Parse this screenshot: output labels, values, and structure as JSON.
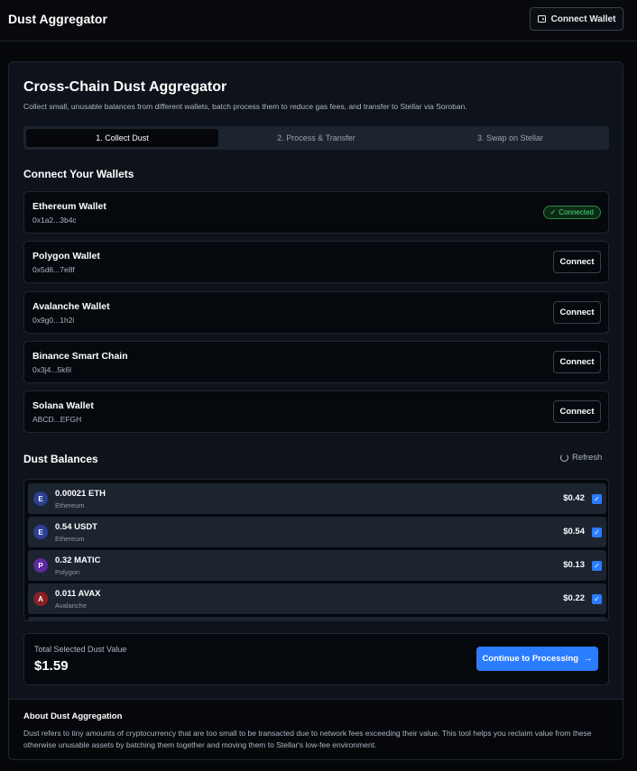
{
  "header": {
    "app_title": "Dust Aggregator",
    "connect_wallet_label": "Connect Wallet"
  },
  "main": {
    "title": "Cross-Chain Dust Aggregator",
    "subtitle": "Collect small, unusable balances from different wallets, batch process them to reduce gas fees, and transfer to Stellar via Soroban.",
    "steps": [
      {
        "label": "1. Collect Dust",
        "active": true
      },
      {
        "label": "2. Process & Transfer",
        "active": false
      },
      {
        "label": "3. Swap on Stellar",
        "active": false
      }
    ],
    "wallets_title": "Connect Your Wallets",
    "wallets": [
      {
        "name": "Ethereum Wallet",
        "address": "0x1a2...3b4c",
        "status": "Connected"
      },
      {
        "name": "Polygon Wallet",
        "address": "0x5d6...7e8f",
        "action": "Connect"
      },
      {
        "name": "Avalanche Wallet",
        "address": "0x9g0...1h2i",
        "action": "Connect"
      },
      {
        "name": "Binance Smart Chain",
        "address": "0x3j4...5k6l",
        "action": "Connect"
      },
      {
        "name": "Solana Wallet",
        "address": "ABCD...EFGH",
        "action": "Connect"
      }
    ],
    "dust_title": "Dust Balances",
    "refresh_label": "Refresh",
    "dust": [
      {
        "letter": "E",
        "amount": "0.00021 ETH",
        "chain": "Ethereum",
        "value": "$0.42",
        "color": "#2d3f91",
        "checked": true
      },
      {
        "letter": "E",
        "amount": "0.54 USDT",
        "chain": "Ethereum",
        "value": "$0.54",
        "color": "#2d3f91",
        "checked": true
      },
      {
        "letter": "P",
        "amount": "0.32 MATIC",
        "chain": "Polygon",
        "value": "$0.13",
        "color": "#5b2a9c",
        "checked": true
      },
      {
        "letter": "A",
        "amount": "0.011 AVAX",
        "chain": "Avalanche",
        "value": "$0.22",
        "color": "#8a1f24",
        "checked": true
      }
    ],
    "total_label": "Total Selected Dust Value",
    "total_value": "$1.59",
    "continue_label": "Continue to Processing"
  },
  "about": {
    "title": "About Dust Aggregation",
    "text": "Dust refers to tiny amounts of cryptocurrency that are too small to be transacted due to network fees exceeding their value. This tool helps you reclaim value from these otherwise unusable assets by batching them together and moving them to Stellar's low-fee environment."
  },
  "colors": {
    "accent": "#2b7cff",
    "connected_green": "#4ade80"
  }
}
